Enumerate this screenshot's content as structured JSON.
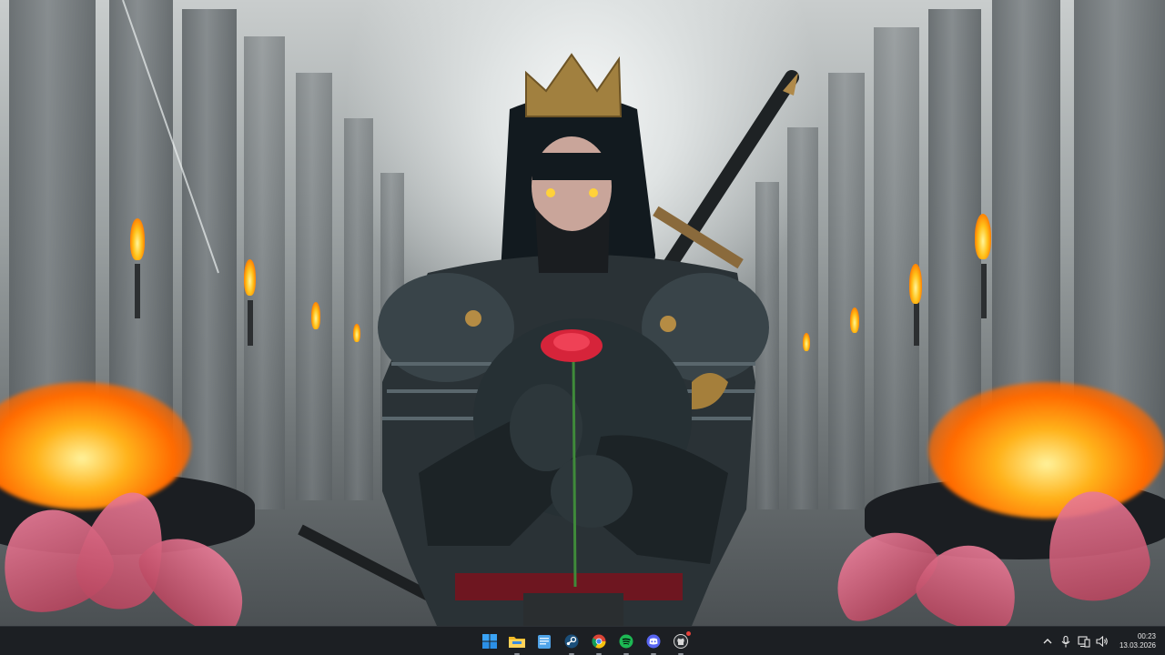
{
  "taskbar": {
    "apps": [
      {
        "name": "Start",
        "icon": "windows-start-icon"
      },
      {
        "name": "File Explorer",
        "icon": "folder-icon"
      },
      {
        "name": "Notepad",
        "icon": "notepad-icon"
      },
      {
        "name": "Steam",
        "icon": "steam-icon"
      },
      {
        "name": "Google Chrome",
        "icon": "chrome-icon"
      },
      {
        "name": "Spotify",
        "icon": "spotify-icon"
      },
      {
        "name": "Discord",
        "icon": "discord-icon"
      },
      {
        "name": "GitHub Desktop",
        "icon": "github-icon"
      }
    ],
    "tray": {
      "icons": [
        "chevron-up-icon",
        "microphone-icon",
        "network-icon",
        "volume-icon"
      ]
    },
    "clock": {
      "time": "00:23",
      "date": "13.03.2026"
    }
  },
  "colors": {
    "taskbar_bg": "#1c1f23",
    "accent": "#0078d4"
  }
}
